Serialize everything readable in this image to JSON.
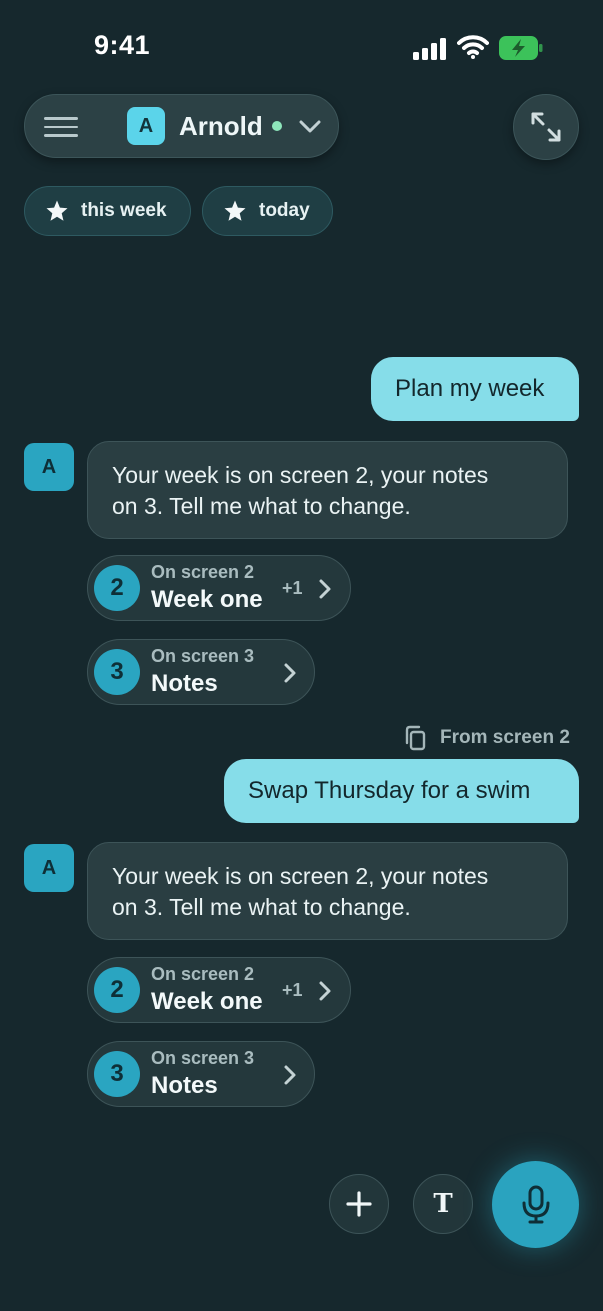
{
  "status_bar": {
    "time": "9:41"
  },
  "header": {
    "agent_initial": "A",
    "agent_name": "Arnold",
    "online_color": "#8ee6bb"
  },
  "filters": [
    {
      "label": "this week",
      "icon": "star-icon"
    },
    {
      "label": "today",
      "icon": "star-icon"
    }
  ],
  "conversation": {
    "user_message_1": "Plan my week",
    "agent_initial": "A",
    "agent_reply_1_lines": [
      "Your week is on screen 2, your notes",
      "on 3. Tell me what to change."
    ],
    "screen_cards_1": [
      {
        "num": "2",
        "label": "On screen 2",
        "title": "Week one",
        "extra": "+1"
      },
      {
        "num": "3",
        "label": "On screen 3",
        "title": "Notes"
      }
    ],
    "from_screen": "From screen 2",
    "user_message_2": "Swap Thursday for a swim",
    "agent_reply_2_lines": [
      "Your week is on screen 2, your notes",
      "on 3. Tell me what to change."
    ],
    "screen_cards_2": [
      {
        "num": "2",
        "label": "On screen 2",
        "title": "Week one",
        "extra": "+1"
      },
      {
        "num": "3",
        "label": "On screen 3",
        "title": "Notes"
      }
    ]
  },
  "actions": {
    "text_button_label": "T"
  },
  "colors": {
    "background": "#16282d",
    "accent": "#2aa5c1",
    "user_bubble": "#86dde9"
  }
}
